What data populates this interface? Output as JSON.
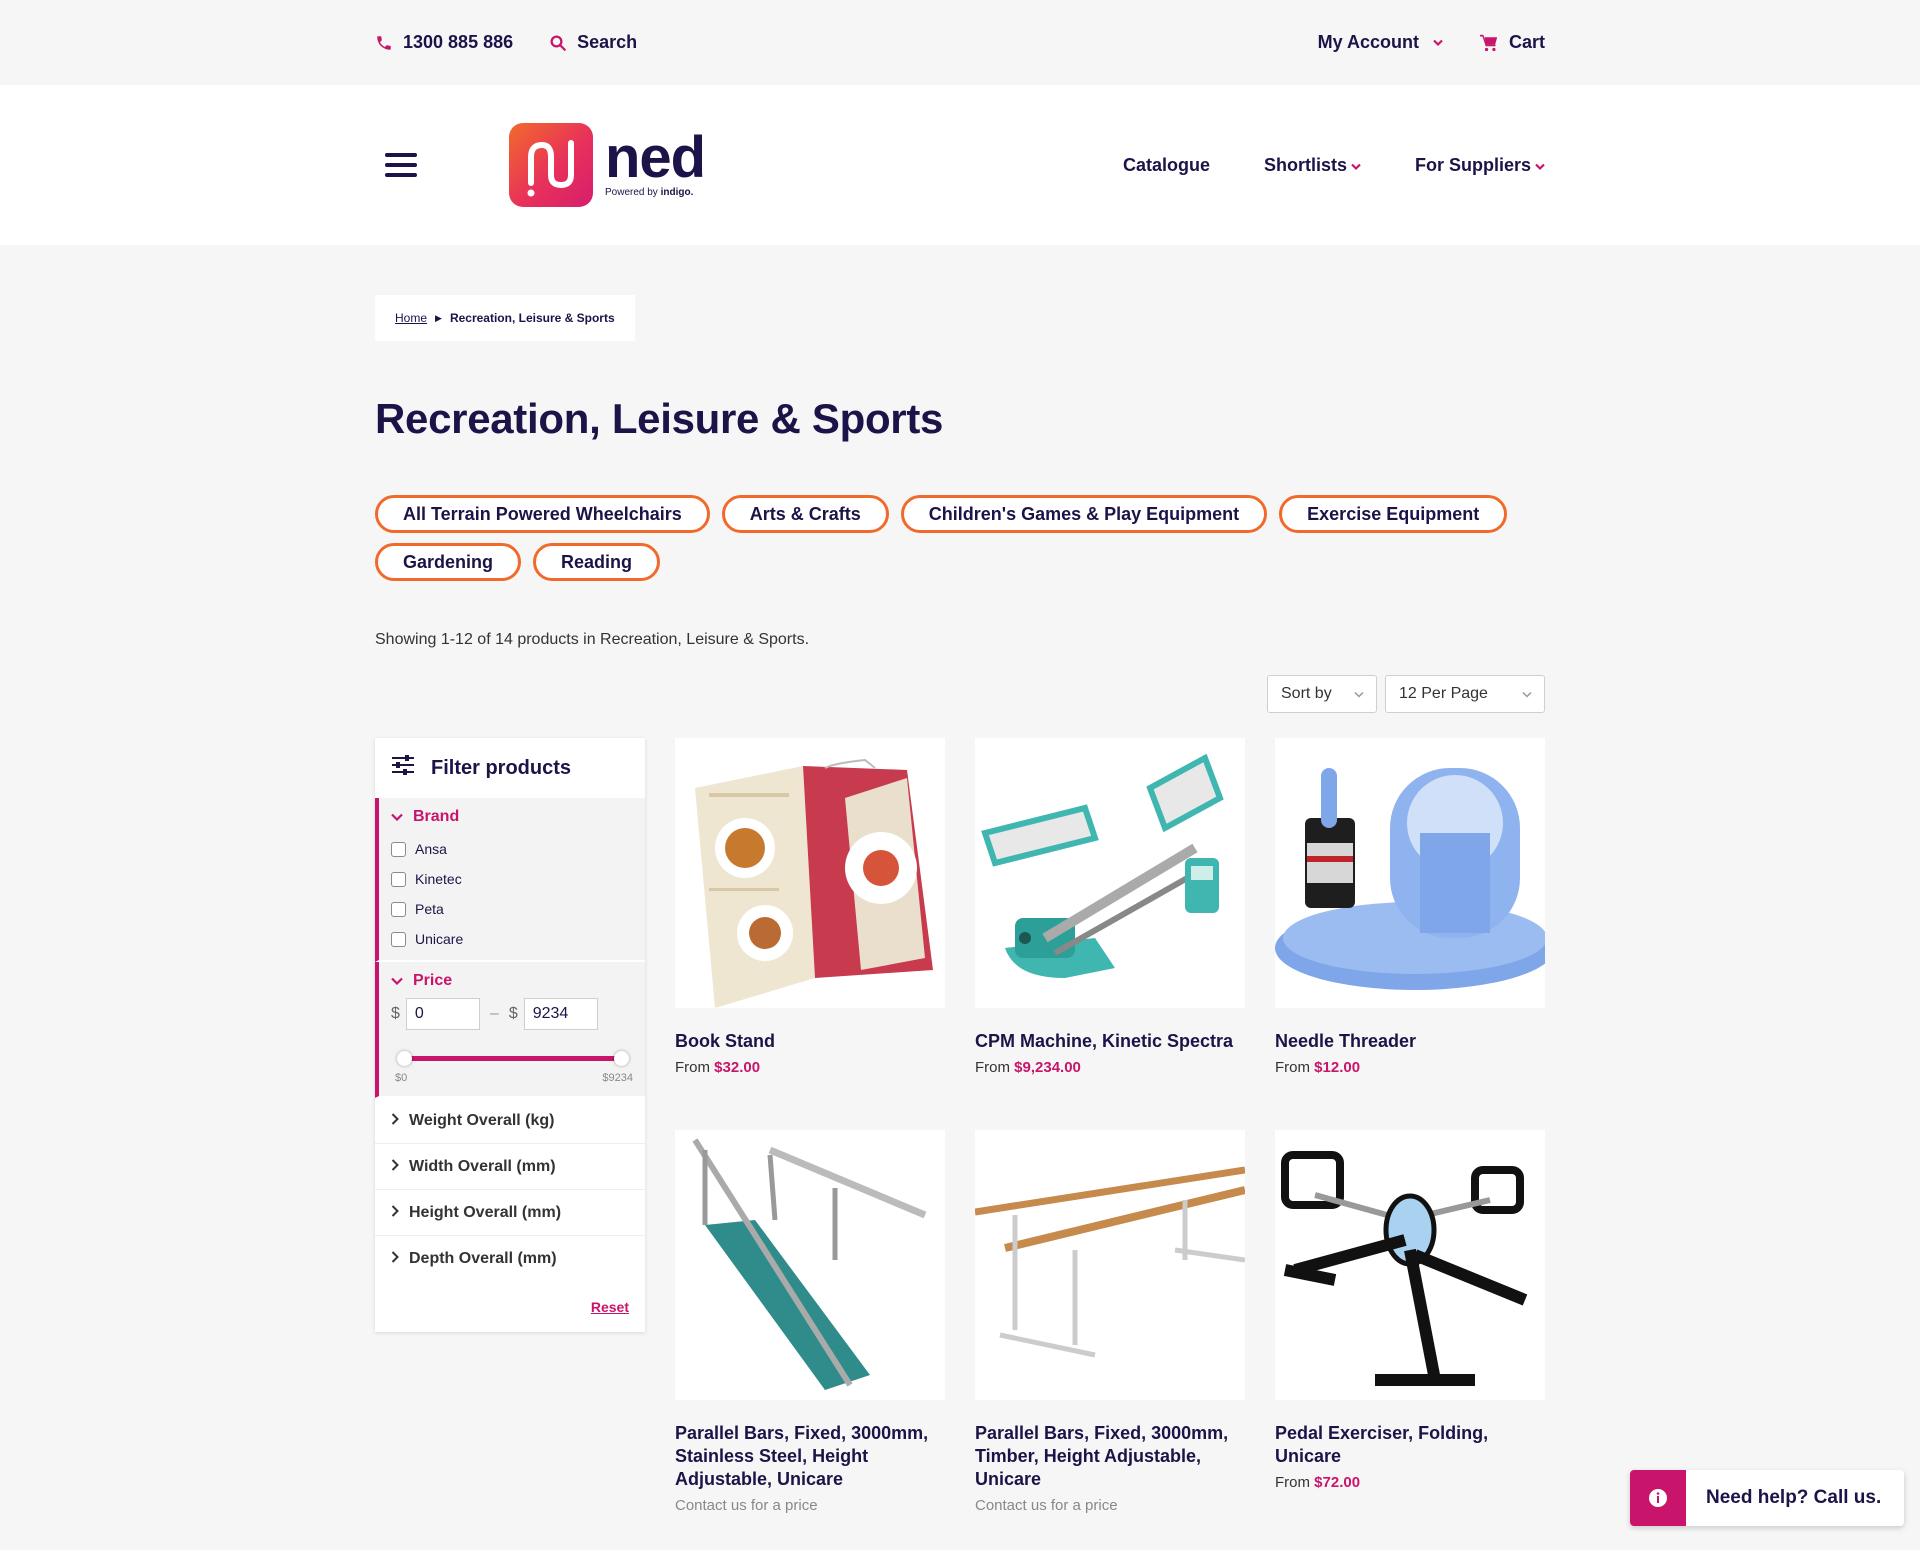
{
  "topbar": {
    "phone": "1300 885 886",
    "search_label": "Search",
    "account_label": "My Account",
    "cart_label": "Cart"
  },
  "header": {
    "logo_word": "ned",
    "logo_sub_prefix": "Powered by",
    "logo_sub_brand": "indigo.",
    "nav": [
      "Catalogue",
      "Shortlists",
      "For Suppliers"
    ]
  },
  "breadcrumb": {
    "home": "Home",
    "current": "Recreation, Leisure & Sports"
  },
  "page_title": "Recreation, Leisure & Sports",
  "categories": [
    "All Terrain Powered Wheelchairs",
    "Arts & Crafts",
    "Children's Games & Play Equipment",
    "Exercise Equipment",
    "Gardening",
    "Reading"
  ],
  "showing_text": "Showing 1-12 of 14 products in Recreation, Leisure & Sports.",
  "sort": {
    "sort_label": "Sort by",
    "per_page_label": "12 Per Page"
  },
  "filters": {
    "title": "Filter products",
    "brand": {
      "title": "Brand",
      "options": [
        "Ansa",
        "Kinetec",
        "Peta",
        "Unicare"
      ]
    },
    "price": {
      "title": "Price",
      "currency": "$",
      "dash": "–",
      "min_value": "0",
      "max_value": "9234",
      "min_label": "$0",
      "max_label": "$9234",
      "range_low_fraction": 0,
      "range_high_fraction": 1
    },
    "collapsed": [
      "Weight Overall (kg)",
      "Width Overall (mm)",
      "Height Overall (mm)",
      "Depth Overall (mm)"
    ],
    "reset": "Reset"
  },
  "products": [
    {
      "name": "Book Stand",
      "price_prefix": "From",
      "price": "$32.00",
      "image": "book-stand"
    },
    {
      "name": "CPM Machine, Kinetic Spectra",
      "price_prefix": "From",
      "price": "$9,234.00",
      "image": "cpm-machine"
    },
    {
      "name": "Needle Threader",
      "price_prefix": "From",
      "price": "$12.00",
      "image": "needle-threader"
    },
    {
      "name": "Parallel Bars, Fixed, 3000mm, Stainless Steel, Height Adjustable, Unicare",
      "contact": "Contact us for a price",
      "image": "parallel-bars-steel"
    },
    {
      "name": "Parallel Bars, Fixed, 3000mm, Timber, Height Adjustable, Unicare",
      "contact": "Contact us for a price",
      "image": "parallel-bars-timber"
    },
    {
      "name": "Pedal Exerciser, Folding, Unicare",
      "price_prefix": "From",
      "price": "$72.00",
      "image": "pedal-exerciser"
    }
  ],
  "help": {
    "label": "Need help? Call us."
  },
  "colors": {
    "navy": "#1c1448",
    "magenta": "#c8156b",
    "orange": "#f26a2b",
    "background": "#f6f6f6"
  }
}
